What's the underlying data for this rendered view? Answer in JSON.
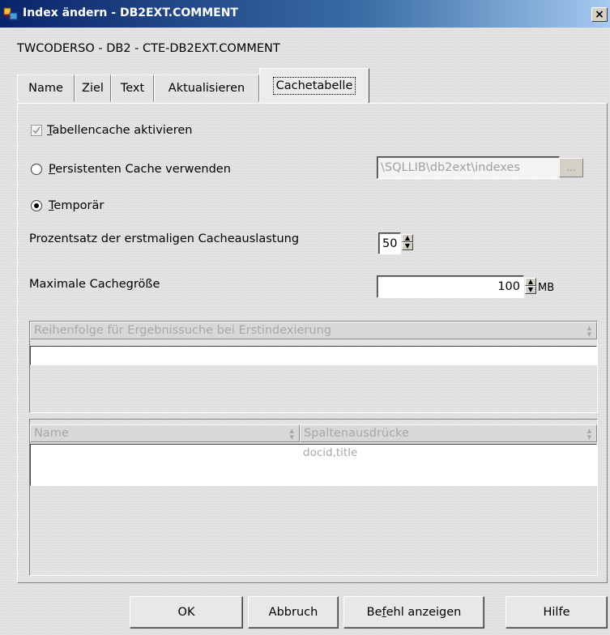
{
  "window": {
    "title": "Index ändern - DB2EXT.COMMENT",
    "close_glyph": "×",
    "subtitle": "TWCODERSO - DB2 - CTE-DB2EXT.COMMENT"
  },
  "tabs": [
    {
      "label": "Name"
    },
    {
      "label": "Ziel"
    },
    {
      "label": "Text"
    },
    {
      "label": "Aktualisieren"
    },
    {
      "label": "Cachetabelle",
      "active": true
    }
  ],
  "cache": {
    "enable_cache": {
      "label_u": "T",
      "label_rest": "abellencache aktivieren",
      "checked": true,
      "disabled": true
    },
    "persistent": {
      "label_u": "P",
      "label_rest": "ersistenten Cache verwenden",
      "selected": false
    },
    "persistent_path": "\\SQLLIB\\db2ext\\indexes",
    "browse_label": "...",
    "temporary": {
      "label_u": "T",
      "label_rest": "emporär",
      "selected": true
    },
    "initial_load_label": "Prozentsatz der erstmaligen Cacheauslastung",
    "initial_load_value": "50",
    "max_size_label": "Maximale Cachegröße",
    "max_size_value": "100",
    "max_size_unit": "MB"
  },
  "search_order": {
    "header": "Reihenfolge für Ergebnissuche bei Erstindexierung",
    "rows": [
      ""
    ]
  },
  "columns_table": {
    "headers": [
      "Name",
      "Spaltenausdrücke"
    ],
    "rows": [
      [
        "",
        "docid,title"
      ]
    ]
  },
  "buttons": {
    "ok": "OK",
    "cancel": "Abbruch",
    "show_command_u": "f",
    "show_command_pre": "Be",
    "show_command_post": "ehl anzeigen",
    "help": "Hilfe"
  },
  "colors": {
    "titlebar_start": "#0a246a",
    "titlebar_end": "#a6caf0",
    "disabled_text": "#a8a8a8"
  }
}
